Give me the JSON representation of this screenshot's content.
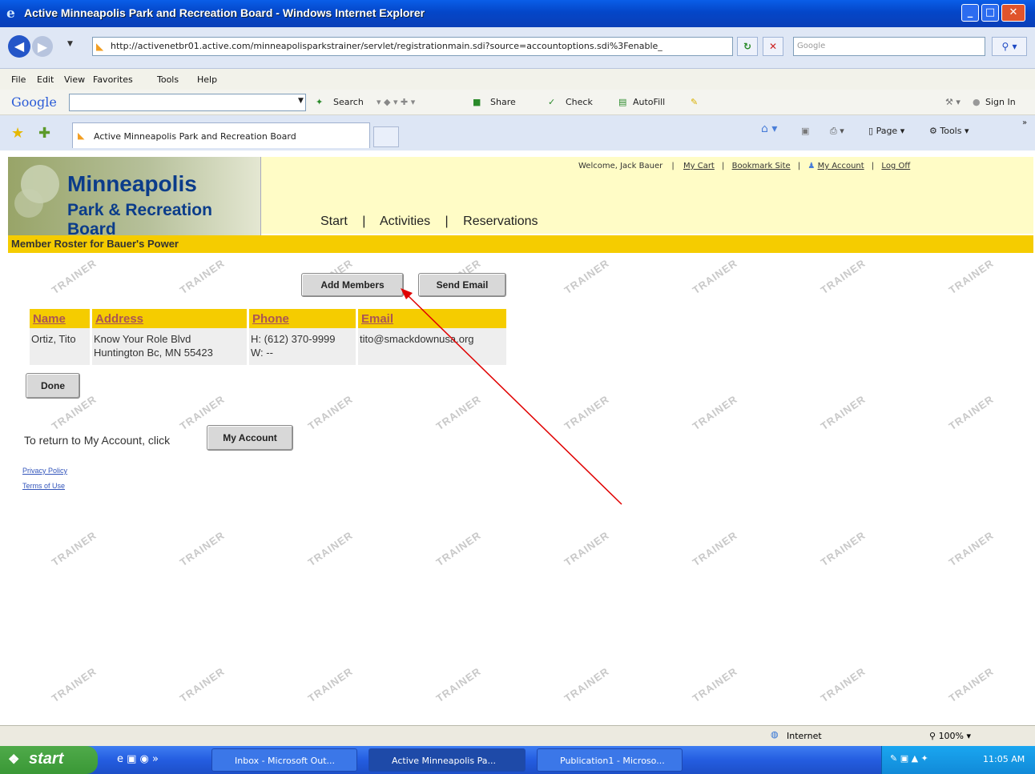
{
  "window": {
    "title": "Active Minneapolis Park and Recreation Board - Windows Internet Explorer"
  },
  "address_bar": {
    "url": "http://activenetbr01.active.com/minneapolisparkstrainer/servlet/registrationmain.sdi?source=accountoptions.sdi%3Fenable_",
    "search_placeholder": "Google"
  },
  "menu": [
    "File",
    "Edit",
    "View",
    "Favorites",
    "Tools",
    "Help"
  ],
  "google_toolbar": {
    "logo": "Google",
    "search": "Search",
    "share": "Share",
    "check": "Check",
    "autofill": "AutoFill",
    "signin": "Sign In"
  },
  "tabs": {
    "active": "Active Minneapolis Park and Recreation Board",
    "page_menu": "Page",
    "tools_menu": "Tools"
  },
  "site": {
    "logo_line1": "Minneapolis",
    "logo_line2": "Park & Recreation Board",
    "welcome": "Welcome, Jack Bauer",
    "links": [
      "My Cart",
      "Bookmark Site",
      "My Account",
      "Log Off"
    ],
    "nav": [
      "Start",
      "Activities",
      "Reservations"
    ],
    "section_title": "Member Roster for Bauer's Power"
  },
  "buttons": {
    "add_members": "Add Members",
    "send_email": "Send Email",
    "done": "Done",
    "my_account": "My Account"
  },
  "roster": {
    "headers": [
      "Name",
      "Address",
      "Phone",
      "Email"
    ],
    "rows": [
      {
        "name": "Ortiz, Tito",
        "address_line1": "Know Your Role Blvd",
        "address_line2": "Huntington Bc, MN 55423",
        "phone_home": "H: (612) 370-9999",
        "phone_work": "W: --",
        "email": "tito@smackdownusa.org"
      }
    ]
  },
  "return_text": "To return to My Account, click",
  "footer_links": [
    "Privacy Policy",
    "Terms of Use"
  ],
  "watermark": "TRAINER",
  "statusbar": {
    "zone": "Internet",
    "zoom": "100%"
  },
  "taskbar": {
    "start": "start",
    "items": [
      "Inbox - Microsoft Out...",
      "Active Minneapolis Pa...",
      "Publication1 - Microso..."
    ],
    "clock": "11:05 AM"
  },
  "colors": {
    "site_header": "#fffcc6",
    "roster_bar": "#f5cc00",
    "annotation_arrow": "#e00000"
  }
}
